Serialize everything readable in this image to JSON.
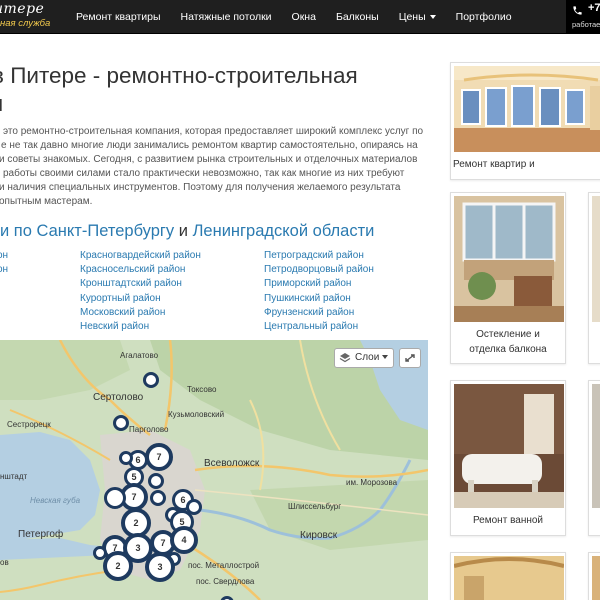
{
  "brand": {
    "name": "итере",
    "tagline": "ная служба"
  },
  "nav": {
    "items": [
      "Ремонт квартиры",
      "Натяжные потолки",
      "Окна",
      "Балконы",
      "Цены",
      "Портфолио"
    ]
  },
  "phone": {
    "number": "+7",
    "subtitle": "работаем"
  },
  "title": {
    "line1": "в Питере - ремонтно-строительная",
    "line2": "я"
  },
  "intro": {
    "lines": [
      "это ремонтно-строительная компания, которая предоставляет широкий комплекс услуг по",
      "е не так давно многие люди занимались ремонтом квартир самостоятельно, опираясь на",
      "и советы знакомых. Сегодня, с развитием рынка строительных и отделочных материалов",
      "работы своими силами стало практически невозможно, так как многие из них требуют",
      "и наличия специальных инструментов. Поэтому для получения желаемого результата",
      "опытным мастерам."
    ]
  },
  "districts": {
    "heading_prefix": "и по",
    "city": "Санкт-Петербургу",
    "and": "и",
    "region": "Ленинградской области",
    "col1": [
      "он",
      "он"
    ],
    "col2": [
      "Красногвардейский район",
      "Красносельский район",
      "Кронштадтский район",
      "Курортный район",
      "Московский район",
      "Невский район"
    ],
    "col3": [
      "Петроградский район",
      "Петродворцовый район",
      "Приморский район",
      "Пушкинский район",
      "Фрунзенский район",
      "Центральный район"
    ]
  },
  "map": {
    "layers_label": "Слои",
    "labels": {
      "agalatovo": "Агалатово",
      "sertolovo": "Сертолово",
      "toksovo": "Токсово",
      "kuzmolovsky": "Кузьмоловский",
      "sestroretsk": "Сестрорецк",
      "pargolovo": "Парголово",
      "kronshtadt": "нштадт",
      "vsevolozhsk": "Всеволожск",
      "morozova": "им. Морозова",
      "shlisselburg": "Шлиссельбург",
      "nevskaya_guba": "Невская губа",
      "peterhof": "Петергоф",
      "kirovsk": "Кировск",
      "metallostroy": "пос. Металлострой",
      "sverdlova": "пос. Свердлова",
      "lomonosov": "ов",
      "toksovo_road": "Сертолово"
    },
    "clusters": [
      "6",
      "7",
      "5",
      "7",
      "6",
      "2",
      "5",
      "7",
      "3",
      "7",
      "4",
      "2",
      "3"
    ]
  },
  "sidebar": {
    "cards": [
      {
        "caption": "Ремонт квартир и"
      },
      {
        "caption_line1": "Остекление и",
        "caption_line2": "отделка балкона"
      },
      {
        "caption": "Ремонт ванной"
      },
      {
        "caption": ""
      }
    ]
  },
  "colors": {
    "nav_bg": "#1f1f1f",
    "link": "#2a7ab0",
    "cluster_border": "#1e3a5f",
    "tagline": "#f2c94c"
  }
}
